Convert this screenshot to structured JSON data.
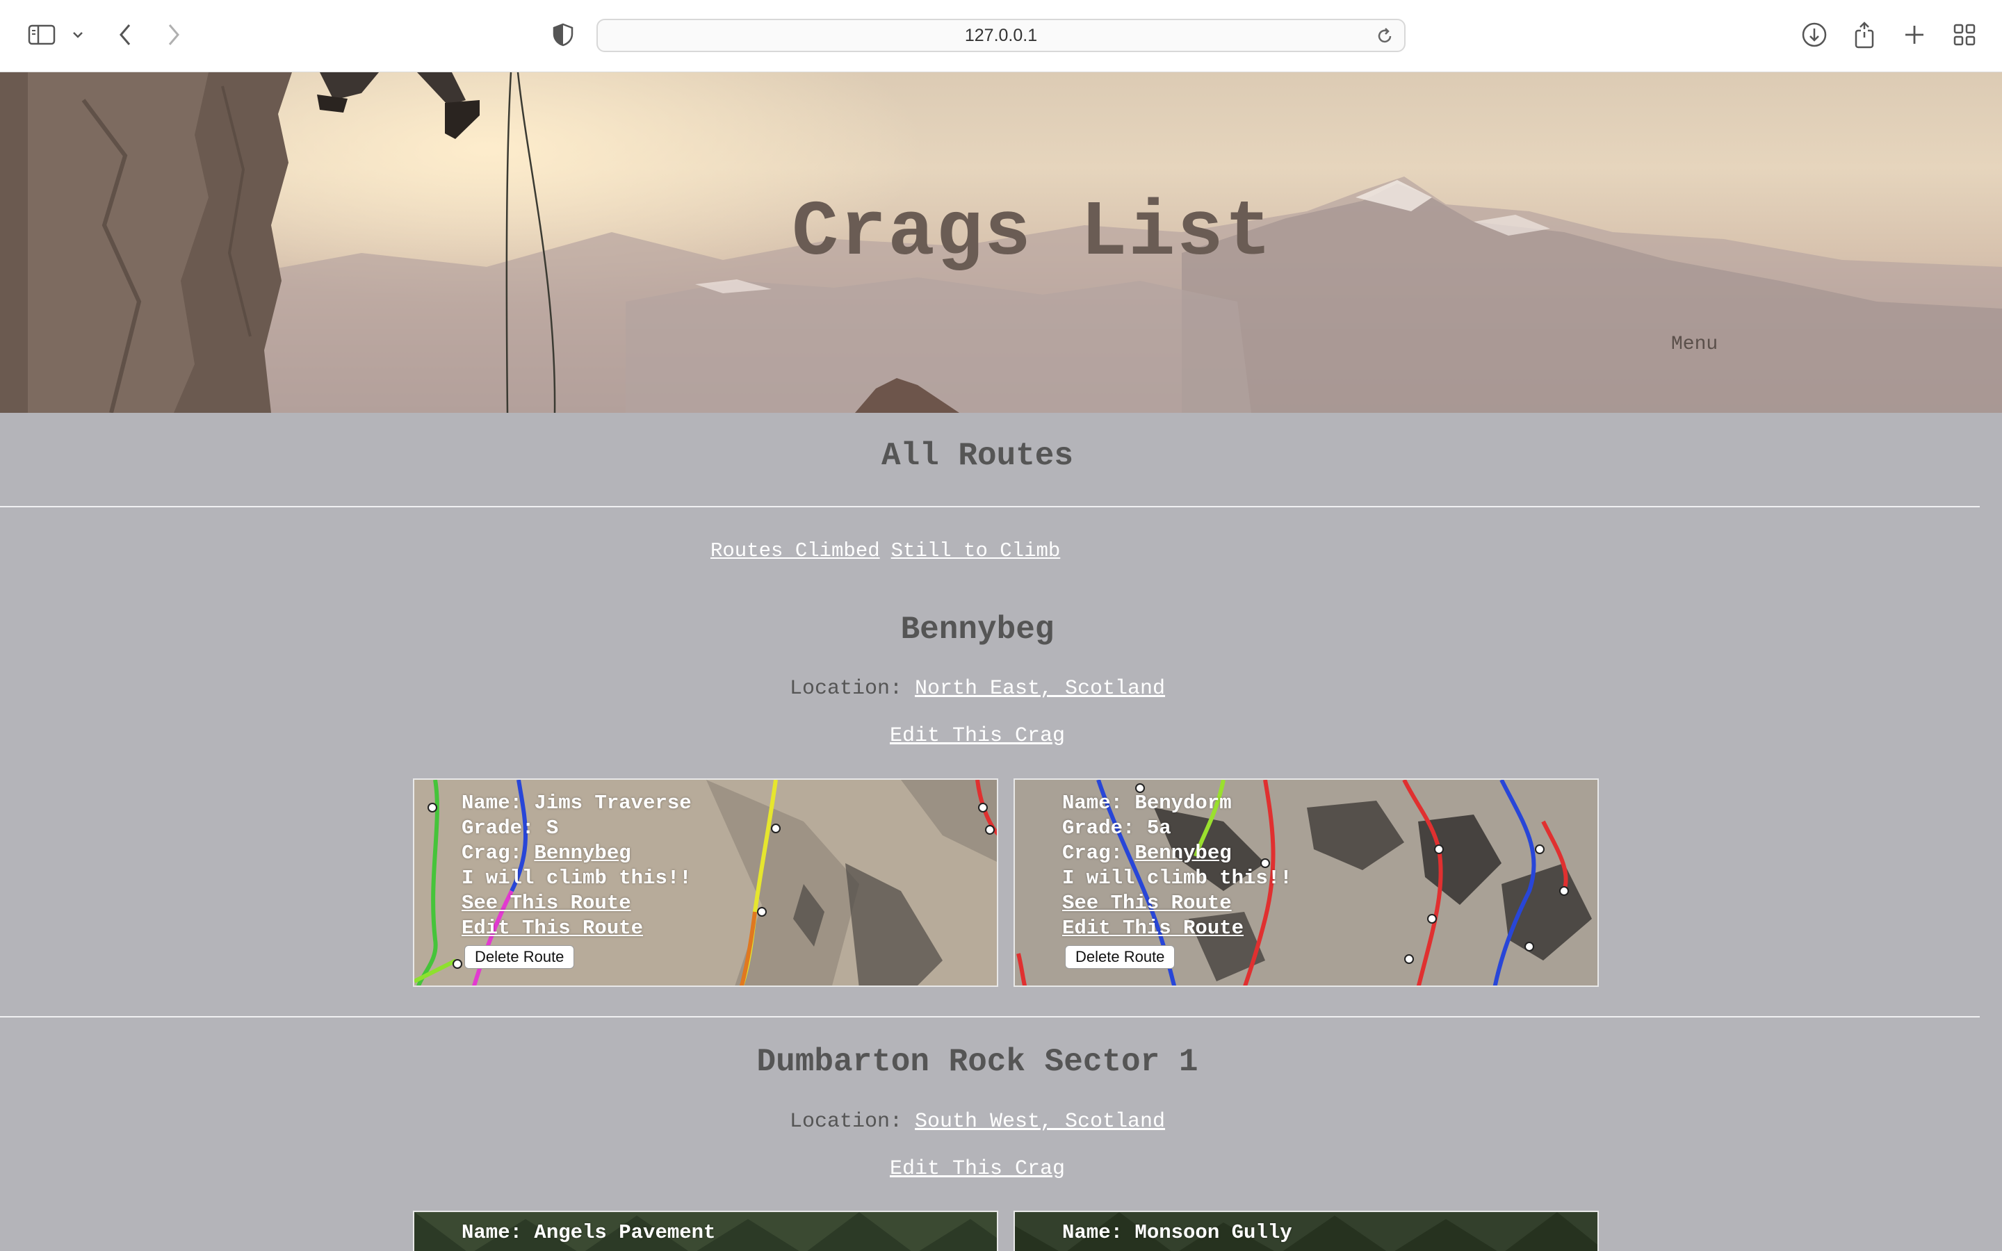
{
  "browser": {
    "url": "127.0.0.1"
  },
  "header": {
    "title": "Crags List",
    "menu_label": "Menu"
  },
  "main": {
    "title": "All Routes",
    "filters": [
      "Routes Climbed",
      "Still to Climb"
    ]
  },
  "labels": {
    "location": "Location:",
    "edit_crag": "Edit This Crag",
    "see_route": "See This Route",
    "edit_route": "Edit This Route",
    "delete_route": "Delete Route",
    "name_prefix": "Name:",
    "grade_prefix": "Grade:",
    "crag_prefix": "Crag:"
  },
  "crags": [
    {
      "name": "Bennybeg",
      "location": "North East, Scotland",
      "routes": [
        {
          "name": "Jims Traverse",
          "grade": "S",
          "crag": "Bennybeg",
          "status": "I will climb this!!"
        },
        {
          "name": "Benydorm",
          "grade": "5a",
          "crag": "Bennybeg",
          "status": "I will climb this!!"
        }
      ]
    },
    {
      "name": "Dumbarton Rock Sector 1",
      "location": "South West, Scotland",
      "routes": [
        {
          "name": "Angels Pavement"
        },
        {
          "name": "Monsoon Gully"
        }
      ]
    }
  ]
}
